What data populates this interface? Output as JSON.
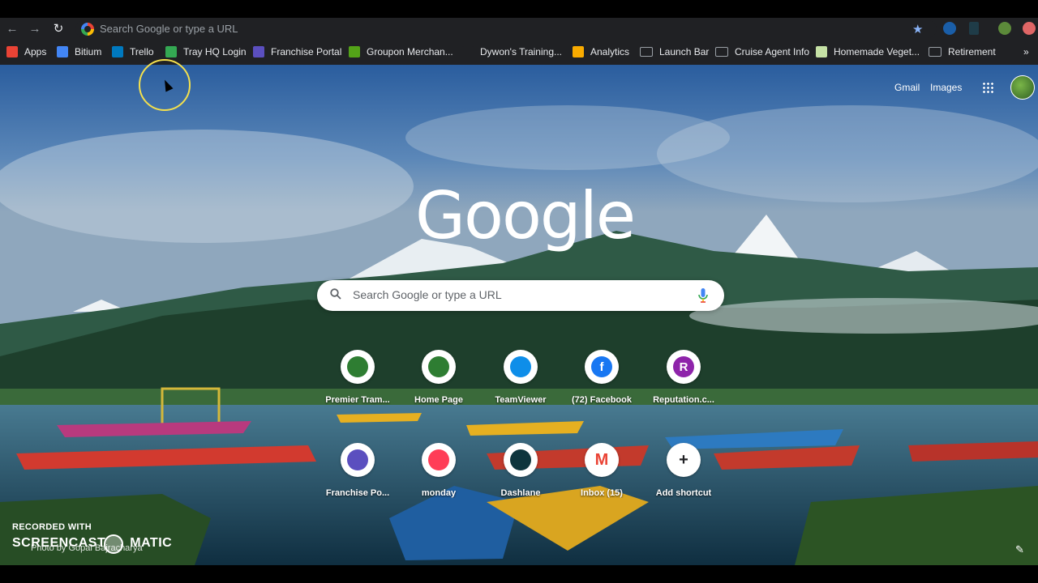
{
  "omnibox": {
    "placeholder": "Search Google or type a URL"
  },
  "nav": {
    "back": "←",
    "forward": "→",
    "reload": "↻"
  },
  "bookmarks": [
    {
      "label": "Apps",
      "icon": "apps-grid-icon",
      "color": "#ea4335"
    },
    {
      "label": "Bitium",
      "icon": "bitium-icon",
      "color": "#4285f4"
    },
    {
      "label": "Trello",
      "icon": "trello-icon",
      "color": "#0079bf"
    },
    {
      "label": "Tray HQ Login",
      "icon": "tray-icon",
      "color": "#34a853"
    },
    {
      "label": "Franchise Portal",
      "icon": "franchise-icon",
      "color": "#5b4fbf"
    },
    {
      "label": "Groupon Merchan...",
      "icon": "groupon-icon",
      "color": "#53a318"
    },
    {
      "label": "Dywon's Training...",
      "icon": "github-icon",
      "color": "#202124"
    },
    {
      "label": "Analytics",
      "icon": "analytics-icon",
      "color": "#f9ab00"
    },
    {
      "label": "Launch Bar",
      "icon": "folder-icon",
      "color": "#9aa0a6"
    },
    {
      "label": "Cruise Agent Info",
      "icon": "folder-icon",
      "color": "#9aa0a6"
    },
    {
      "label": "Homemade Veget...",
      "icon": "page-icon",
      "color": "#c5e1a5"
    },
    {
      "label": "Retirement",
      "icon": "folder-icon",
      "color": "#9aa0a6"
    }
  ],
  "overflow": "»",
  "topright": {
    "gmail": "Gmail",
    "images": "Images"
  },
  "logo": "Google",
  "search": {
    "placeholder": "Search Google or type a URL"
  },
  "shortcuts": [
    {
      "label": "Premier Tram...",
      "glyph": "",
      "color": "#2e7d32"
    },
    {
      "label": "Home Page",
      "glyph": "",
      "color": "#2e7d32"
    },
    {
      "label": "TeamViewer",
      "glyph": "",
      "color": "#0e8ee9"
    },
    {
      "label": "(72) Facebook",
      "glyph": "f",
      "color": "#1877f2"
    },
    {
      "label": "Reputation.c...",
      "glyph": "R",
      "color": "#8e24aa"
    },
    {
      "label": "Franchise Po...",
      "glyph": "",
      "color": "#5b4fbf"
    },
    {
      "label": "monday",
      "glyph": "",
      "color": "#ff3d57"
    },
    {
      "label": "Dashlane",
      "glyph": "",
      "color": "#0e353d"
    },
    {
      "label": "Inbox (15)",
      "glyph": "M",
      "color": "#ea4335"
    },
    {
      "label": "Add shortcut",
      "glyph": "+",
      "color": "#202124"
    }
  ],
  "watermark": {
    "line1": "RECORDED WITH",
    "line2": "SCREENCAST",
    "line2b": "MATIC"
  },
  "credit": "Photo by Gopal Bajracharya",
  "edit_glyph": "✎"
}
